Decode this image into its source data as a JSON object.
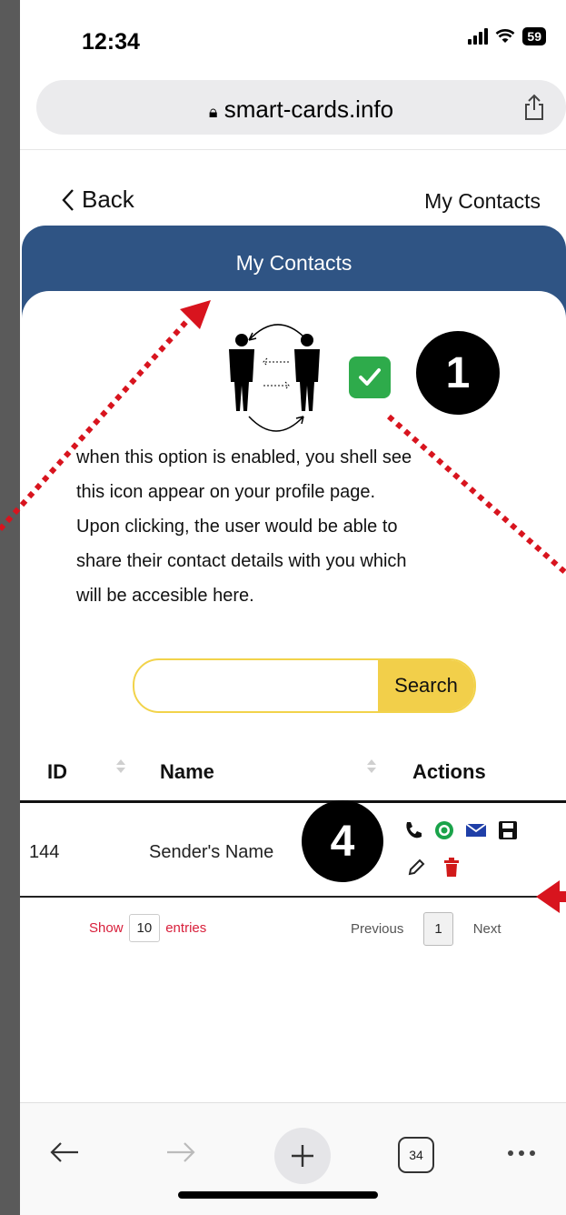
{
  "status_bar": {
    "time": "12:34",
    "battery": "59"
  },
  "browser": {
    "url": "smart-cards.info"
  },
  "nav": {
    "back_label": "Back",
    "page_title": "My Contacts"
  },
  "header": {
    "title": "My Contacts"
  },
  "description": {
    "line1": "when this option is enabled, you shell see",
    "line2": "this icon appear on your profile page.",
    "line3": "Upon clicking, the user would be able to",
    "line4": "share their contact details with you which",
    "line5": "will be accesible here."
  },
  "search": {
    "button_label": "Search",
    "placeholder": "",
    "value": ""
  },
  "table": {
    "columns": [
      "ID",
      "Name",
      "Actions"
    ],
    "rows": [
      {
        "id": "144",
        "name": "Sender's Name"
      }
    ]
  },
  "pagination": {
    "show_label": "Show",
    "entries_count": "10",
    "entries_label": "entries",
    "previous_label": "Previous",
    "current_page": "1",
    "next_label": "Next"
  },
  "toolbar": {
    "tab_count": "34"
  },
  "annotations": {
    "badge_1": "1",
    "badge_4": "4"
  },
  "colors": {
    "header_blue": "#2f5484",
    "search_yellow": "#f2cf4a",
    "check_green": "#2eab4b",
    "arrow_red": "#d8141e"
  }
}
